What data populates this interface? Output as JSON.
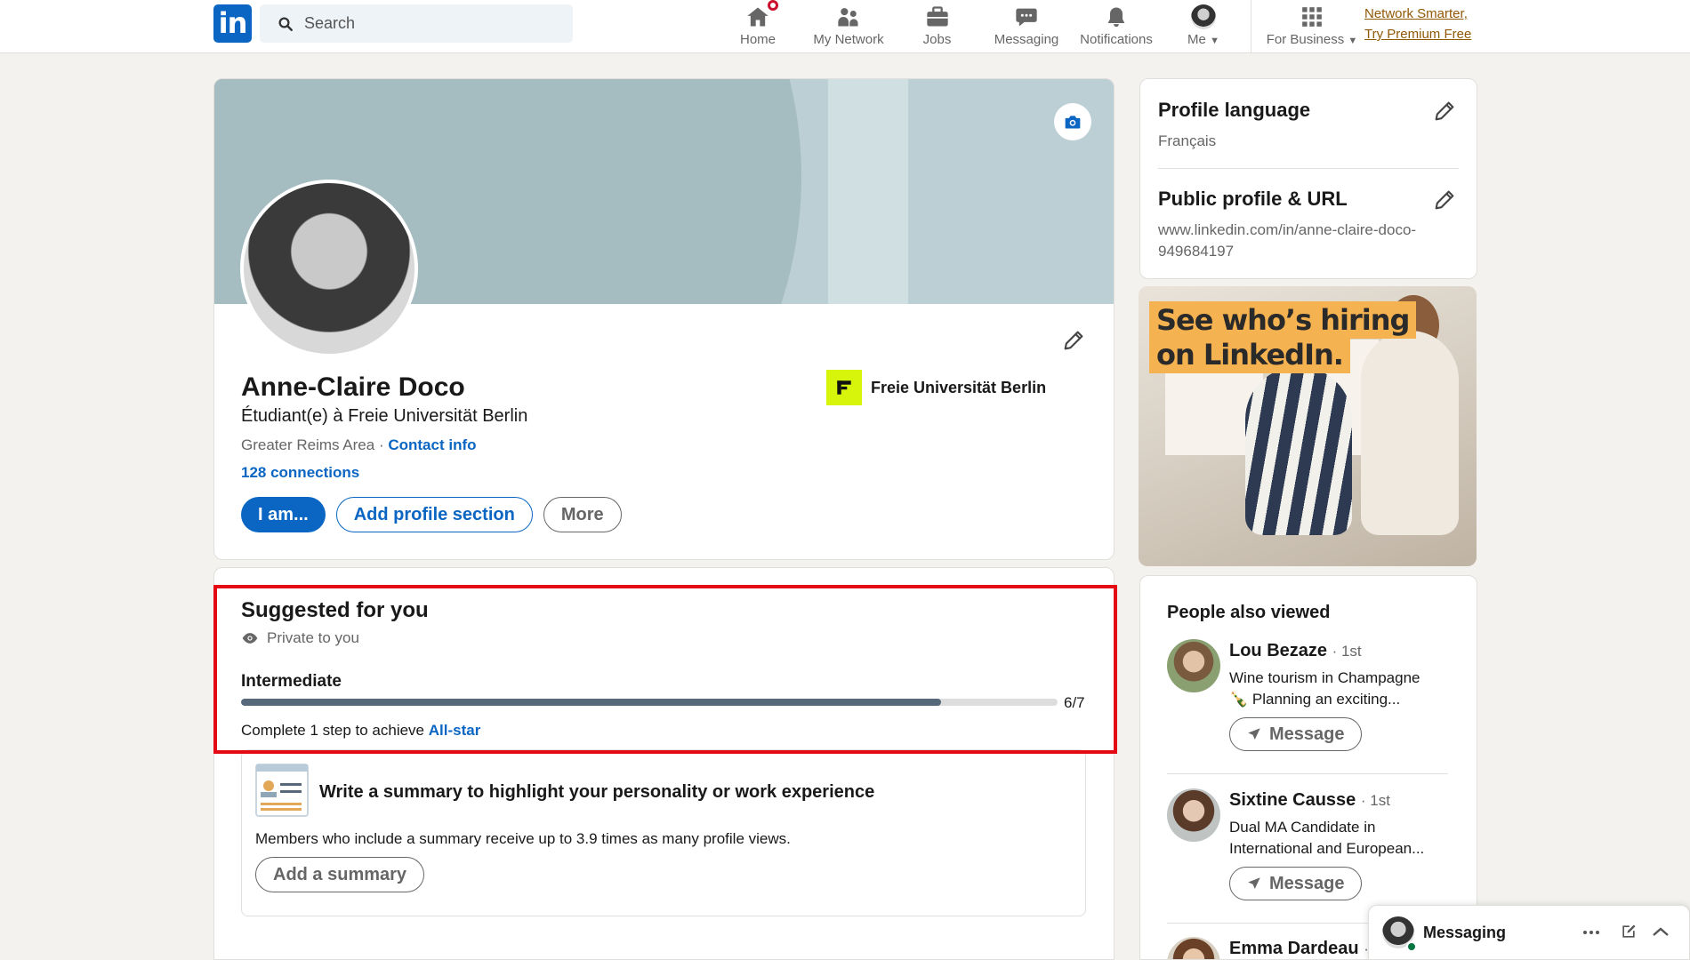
{
  "nav": {
    "search_placeholder": "Search",
    "items": [
      {
        "label": "Home",
        "icon": "home-icon"
      },
      {
        "label": "My Network",
        "icon": "network-icon"
      },
      {
        "label": "Jobs",
        "icon": "jobs-icon"
      },
      {
        "label": "Messaging",
        "icon": "messaging-icon"
      },
      {
        "label": "Notifications",
        "icon": "bell-icon"
      },
      {
        "label": "Me",
        "icon": "avatar"
      },
      {
        "label": "For Business",
        "icon": "grid-icon"
      }
    ],
    "premium_line1": "Network Smarter,",
    "premium_line2": "Try Premium Free"
  },
  "profile": {
    "name": "Anne-Claire Doco",
    "headline": "Étudiant(e) à Freie Universität Berlin",
    "location": "Greater Reims Area",
    "separator": " · ",
    "contact_info": "Contact info",
    "connections": "128 connections",
    "buttons": {
      "primary": "I am...",
      "add_section": "Add profile section",
      "more": "More"
    },
    "organization": "Freie Universität Berlin"
  },
  "suggested": {
    "title": "Suggested for you",
    "private": "Private to you",
    "level": "Intermediate",
    "progress": {
      "done": 6,
      "total": 7,
      "label": "6/7"
    },
    "step_text": "Complete 1 step to achieve ",
    "step_link": "All-star",
    "summary": {
      "title": "Write a summary to highlight your personality or work experience",
      "description": "Members who include a summary receive up to 3.9 times as many profile views.",
      "button": "Add a summary"
    }
  },
  "sidebar": {
    "language_title": "Profile language",
    "language_value": "Français",
    "public_title": "Public profile & URL",
    "public_url_line1": "www.linkedin.com/in/anne-claire-doco-",
    "public_url_line2": "949684197"
  },
  "ad": {
    "line1": "See who’s hiring",
    "line2": "on LinkedIn."
  },
  "people_also_viewed": {
    "title": "People also viewed",
    "people": [
      {
        "name": "Lou Bezaze",
        "degree": "· 1st",
        "headline_line1": "Wine tourism in Champagne",
        "headline_line2": "🍾 Planning an exciting...",
        "button": "Message"
      },
      {
        "name": "Sixtine Causse",
        "degree": "· 1st",
        "headline_line1": "Dual MA Candidate in",
        "headline_line2": "International and European...",
        "button": "Message"
      },
      {
        "name": "Emma Dardeau",
        "degree": "·"
      }
    ]
  },
  "messaging_bar": {
    "label": "Messaging"
  },
  "colors": {
    "brand": "#0a66c2",
    "highlight": "#e50914",
    "background": "#f3f2ef",
    "badge": "#cb112d"
  }
}
